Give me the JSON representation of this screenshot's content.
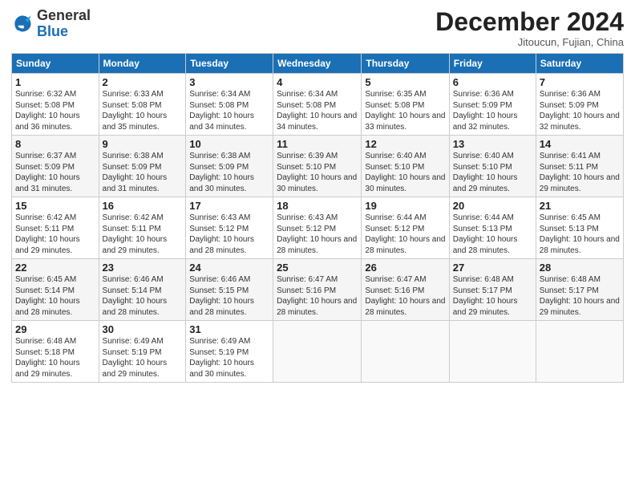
{
  "header": {
    "logo_general": "General",
    "logo_blue": "Blue",
    "month_title": "December 2024",
    "subtitle": "Jitoucun, Fujian, China"
  },
  "weekdays": [
    "Sunday",
    "Monday",
    "Tuesday",
    "Wednesday",
    "Thursday",
    "Friday",
    "Saturday"
  ],
  "weeks": [
    [
      {
        "day": "1",
        "sunrise": "Sunrise: 6:32 AM",
        "sunset": "Sunset: 5:08 PM",
        "daylight": "Daylight: 10 hours and 36 minutes."
      },
      {
        "day": "2",
        "sunrise": "Sunrise: 6:33 AM",
        "sunset": "Sunset: 5:08 PM",
        "daylight": "Daylight: 10 hours and 35 minutes."
      },
      {
        "day": "3",
        "sunrise": "Sunrise: 6:34 AM",
        "sunset": "Sunset: 5:08 PM",
        "daylight": "Daylight: 10 hours and 34 minutes."
      },
      {
        "day": "4",
        "sunrise": "Sunrise: 6:34 AM",
        "sunset": "Sunset: 5:08 PM",
        "daylight": "Daylight: 10 hours and 34 minutes."
      },
      {
        "day": "5",
        "sunrise": "Sunrise: 6:35 AM",
        "sunset": "Sunset: 5:08 PM",
        "daylight": "Daylight: 10 hours and 33 minutes."
      },
      {
        "day": "6",
        "sunrise": "Sunrise: 6:36 AM",
        "sunset": "Sunset: 5:09 PM",
        "daylight": "Daylight: 10 hours and 32 minutes."
      },
      {
        "day": "7",
        "sunrise": "Sunrise: 6:36 AM",
        "sunset": "Sunset: 5:09 PM",
        "daylight": "Daylight: 10 hours and 32 minutes."
      }
    ],
    [
      {
        "day": "8",
        "sunrise": "Sunrise: 6:37 AM",
        "sunset": "Sunset: 5:09 PM",
        "daylight": "Daylight: 10 hours and 31 minutes."
      },
      {
        "day": "9",
        "sunrise": "Sunrise: 6:38 AM",
        "sunset": "Sunset: 5:09 PM",
        "daylight": "Daylight: 10 hours and 31 minutes."
      },
      {
        "day": "10",
        "sunrise": "Sunrise: 6:38 AM",
        "sunset": "Sunset: 5:09 PM",
        "daylight": "Daylight: 10 hours and 30 minutes."
      },
      {
        "day": "11",
        "sunrise": "Sunrise: 6:39 AM",
        "sunset": "Sunset: 5:10 PM",
        "daylight": "Daylight: 10 hours and 30 minutes."
      },
      {
        "day": "12",
        "sunrise": "Sunrise: 6:40 AM",
        "sunset": "Sunset: 5:10 PM",
        "daylight": "Daylight: 10 hours and 30 minutes."
      },
      {
        "day": "13",
        "sunrise": "Sunrise: 6:40 AM",
        "sunset": "Sunset: 5:10 PM",
        "daylight": "Daylight: 10 hours and 29 minutes."
      },
      {
        "day": "14",
        "sunrise": "Sunrise: 6:41 AM",
        "sunset": "Sunset: 5:11 PM",
        "daylight": "Daylight: 10 hours and 29 minutes."
      }
    ],
    [
      {
        "day": "15",
        "sunrise": "Sunrise: 6:42 AM",
        "sunset": "Sunset: 5:11 PM",
        "daylight": "Daylight: 10 hours and 29 minutes."
      },
      {
        "day": "16",
        "sunrise": "Sunrise: 6:42 AM",
        "sunset": "Sunset: 5:11 PM",
        "daylight": "Daylight: 10 hours and 29 minutes."
      },
      {
        "day": "17",
        "sunrise": "Sunrise: 6:43 AM",
        "sunset": "Sunset: 5:12 PM",
        "daylight": "Daylight: 10 hours and 28 minutes."
      },
      {
        "day": "18",
        "sunrise": "Sunrise: 6:43 AM",
        "sunset": "Sunset: 5:12 PM",
        "daylight": "Daylight: 10 hours and 28 minutes."
      },
      {
        "day": "19",
        "sunrise": "Sunrise: 6:44 AM",
        "sunset": "Sunset: 5:12 PM",
        "daylight": "Daylight: 10 hours and 28 minutes."
      },
      {
        "day": "20",
        "sunrise": "Sunrise: 6:44 AM",
        "sunset": "Sunset: 5:13 PM",
        "daylight": "Daylight: 10 hours and 28 minutes."
      },
      {
        "day": "21",
        "sunrise": "Sunrise: 6:45 AM",
        "sunset": "Sunset: 5:13 PM",
        "daylight": "Daylight: 10 hours and 28 minutes."
      }
    ],
    [
      {
        "day": "22",
        "sunrise": "Sunrise: 6:45 AM",
        "sunset": "Sunset: 5:14 PM",
        "daylight": "Daylight: 10 hours and 28 minutes."
      },
      {
        "day": "23",
        "sunrise": "Sunrise: 6:46 AM",
        "sunset": "Sunset: 5:14 PM",
        "daylight": "Daylight: 10 hours and 28 minutes."
      },
      {
        "day": "24",
        "sunrise": "Sunrise: 6:46 AM",
        "sunset": "Sunset: 5:15 PM",
        "daylight": "Daylight: 10 hours and 28 minutes."
      },
      {
        "day": "25",
        "sunrise": "Sunrise: 6:47 AM",
        "sunset": "Sunset: 5:16 PM",
        "daylight": "Daylight: 10 hours and 28 minutes."
      },
      {
        "day": "26",
        "sunrise": "Sunrise: 6:47 AM",
        "sunset": "Sunset: 5:16 PM",
        "daylight": "Daylight: 10 hours and 28 minutes."
      },
      {
        "day": "27",
        "sunrise": "Sunrise: 6:48 AM",
        "sunset": "Sunset: 5:17 PM",
        "daylight": "Daylight: 10 hours and 29 minutes."
      },
      {
        "day": "28",
        "sunrise": "Sunrise: 6:48 AM",
        "sunset": "Sunset: 5:17 PM",
        "daylight": "Daylight: 10 hours and 29 minutes."
      }
    ],
    [
      {
        "day": "29",
        "sunrise": "Sunrise: 6:48 AM",
        "sunset": "Sunset: 5:18 PM",
        "daylight": "Daylight: 10 hours and 29 minutes."
      },
      {
        "day": "30",
        "sunrise": "Sunrise: 6:49 AM",
        "sunset": "Sunset: 5:19 PM",
        "daylight": "Daylight: 10 hours and 29 minutes."
      },
      {
        "day": "31",
        "sunrise": "Sunrise: 6:49 AM",
        "sunset": "Sunset: 5:19 PM",
        "daylight": "Daylight: 10 hours and 30 minutes."
      },
      {
        "day": "",
        "sunrise": "",
        "sunset": "",
        "daylight": ""
      },
      {
        "day": "",
        "sunrise": "",
        "sunset": "",
        "daylight": ""
      },
      {
        "day": "",
        "sunrise": "",
        "sunset": "",
        "daylight": ""
      },
      {
        "day": "",
        "sunrise": "",
        "sunset": "",
        "daylight": ""
      }
    ]
  ]
}
